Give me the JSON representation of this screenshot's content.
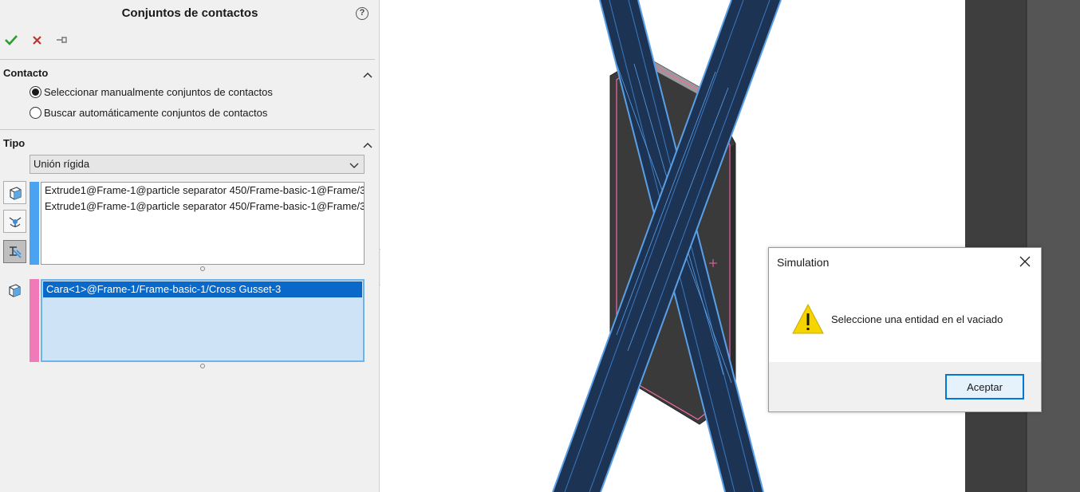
{
  "panel": {
    "title": "Conjuntos de contactos",
    "help_label": "?",
    "toolbar": {
      "ok_icon": "checkmark-icon",
      "cancel_icon": "x-icon",
      "pin_icon": "pushpin-icon"
    }
  },
  "contact_section": {
    "title": "Contacto",
    "options": [
      {
        "label": "Seleccionar manualmente conjuntos de contactos",
        "selected": true
      },
      {
        "label": "Buscar automáticamente conjuntos de contactos",
        "selected": false
      }
    ]
  },
  "type_section": {
    "title": "Tipo",
    "selected_type": "Unión rígida",
    "set1_items": [
      "Extrude1@Frame-1@particle separator 450/Frame-basic-1@Frame/3",
      "Extrude1@Frame-1@particle separator 450/Frame-basic-1@Frame/3"
    ],
    "set2_items": [
      "Cara<1>@Frame-1/Frame-basic-1/Cross Gusset-3"
    ],
    "set1_color": "#4aa3f0",
    "set2_color": "#f07ab8"
  },
  "dialog": {
    "title": "Simulation",
    "message": "Seleccione una entidad en el vaciado",
    "ok_label": "Aceptar",
    "icon": "warning-icon"
  },
  "colors": {
    "beam": "#1c3354",
    "beam_edge": "#5aa0e6",
    "gusset": "#3f3f3f",
    "highlight": "#f06aa6",
    "accent": "#0078d7"
  }
}
